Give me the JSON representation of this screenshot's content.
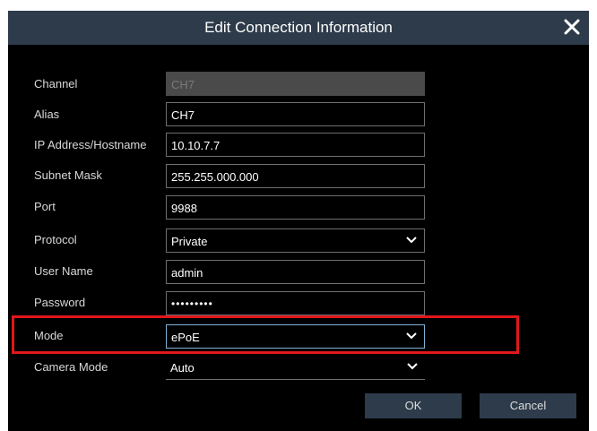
{
  "dialog": {
    "title": "Edit Connection Information",
    "close_icon": "close-icon"
  },
  "fields": {
    "channel": {
      "label": "Channel",
      "value": "CH7",
      "disabled": true
    },
    "alias": {
      "label": "Alias",
      "value": "CH7"
    },
    "ip": {
      "label": "IP Address/Hostname",
      "value": "10.10.7.7"
    },
    "subnet": {
      "label": "Subnet Mask",
      "value": "255.255.000.000"
    },
    "port": {
      "label": "Port",
      "value": "9988"
    },
    "protocol": {
      "label": "Protocol",
      "value": "Private"
    },
    "username": {
      "label": "User Name",
      "value": "admin"
    },
    "password": {
      "label": "Password",
      "value": "•••••••••"
    },
    "mode": {
      "label": "Mode",
      "value": "ePoE"
    },
    "camera_mode": {
      "label": "Camera Mode",
      "value": "Auto"
    }
  },
  "buttons": {
    "ok": "OK",
    "cancel": "Cancel"
  },
  "colors": {
    "title_bar": "#2d3b4a",
    "highlight": "#e0171b",
    "button": "#2d3b4a"
  }
}
